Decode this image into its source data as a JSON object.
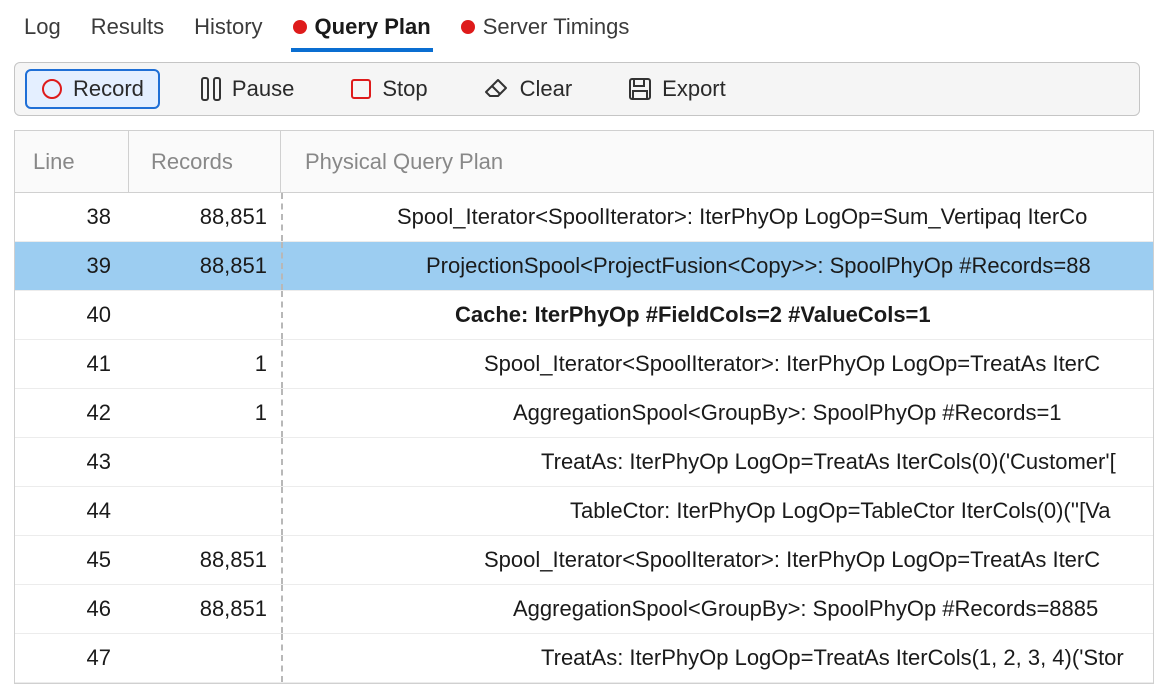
{
  "tabs": [
    {
      "label": "Log",
      "active": false,
      "dot": false
    },
    {
      "label": "Results",
      "active": false,
      "dot": false
    },
    {
      "label": "History",
      "active": false,
      "dot": false
    },
    {
      "label": "Query Plan",
      "active": true,
      "dot": true
    },
    {
      "label": "Server Timings",
      "active": false,
      "dot": true
    }
  ],
  "toolbar": {
    "record": "Record",
    "pause": "Pause",
    "stop": "Stop",
    "clear": "Clear",
    "export": "Export"
  },
  "grid": {
    "headers": {
      "line": "Line",
      "records": "Records",
      "plan": "Physical Query Plan"
    },
    "rows": [
      {
        "line": "38",
        "records": "88,851",
        "indent": 380,
        "text": "Spool_Iterator<SpoolIterator>: IterPhyOp LogOp=Sum_Vertipaq IterCo",
        "bold": false,
        "selected": false
      },
      {
        "line": "39",
        "records": "88,851",
        "indent": 409,
        "text": "ProjectionSpool<ProjectFusion<Copy>>: SpoolPhyOp #Records=88",
        "bold": false,
        "selected": true
      },
      {
        "line": "40",
        "records": "",
        "indent": 438,
        "text": "Cache: IterPhyOp #FieldCols=2 #ValueCols=1",
        "bold": true,
        "selected": false
      },
      {
        "line": "41",
        "records": "1",
        "indent": 467,
        "text": "Spool_Iterator<SpoolIterator>: IterPhyOp LogOp=TreatAs IterC",
        "bold": false,
        "selected": false
      },
      {
        "line": "42",
        "records": "1",
        "indent": 496,
        "text": "AggregationSpool<GroupBy>: SpoolPhyOp #Records=1",
        "bold": false,
        "selected": false
      },
      {
        "line": "43",
        "records": "",
        "indent": 524,
        "text": "TreatAs: IterPhyOp LogOp=TreatAs IterCols(0)('Customer'[",
        "bold": false,
        "selected": false
      },
      {
        "line": "44",
        "records": "",
        "indent": 553,
        "text": "TableCtor: IterPhyOp LogOp=TableCtor IterCols(0)(''[Va",
        "bold": false,
        "selected": false
      },
      {
        "line": "45",
        "records": "88,851",
        "indent": 467,
        "text": "Spool_Iterator<SpoolIterator>: IterPhyOp LogOp=TreatAs IterC",
        "bold": false,
        "selected": false
      },
      {
        "line": "46",
        "records": "88,851",
        "indent": 496,
        "text": "AggregationSpool<GroupBy>: SpoolPhyOp #Records=8885",
        "bold": false,
        "selected": false
      },
      {
        "line": "47",
        "records": "",
        "indent": 524,
        "text": "TreatAs: IterPhyOp LogOp=TreatAs IterCols(1, 2, 3, 4)('Stor",
        "bold": false,
        "selected": false
      }
    ]
  }
}
